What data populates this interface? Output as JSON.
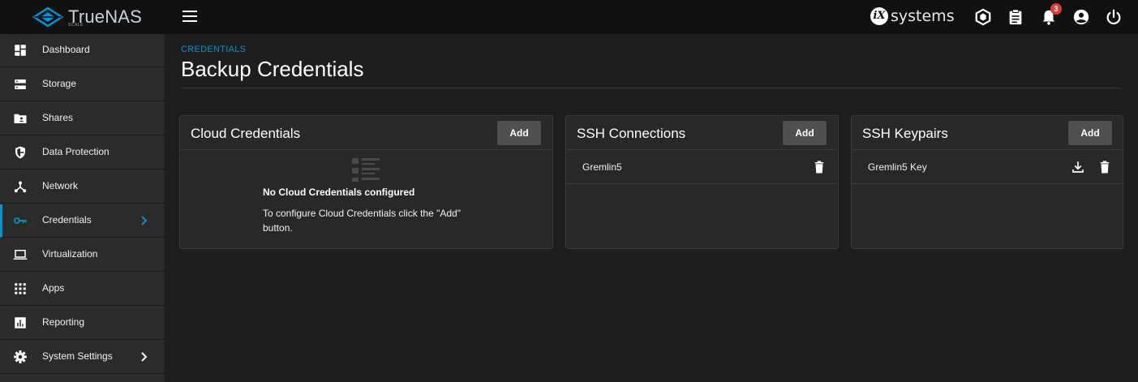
{
  "app": {
    "logo_brand": "TrueNAS",
    "logo_edition": "SCALE",
    "vendor_badge": "iX",
    "vendor_name": "systems",
    "notifications_count": "3"
  },
  "sidebar": {
    "items": [
      {
        "label": "Dashboard",
        "icon": "dashboard-icon"
      },
      {
        "label": "Storage",
        "icon": "storage-icon"
      },
      {
        "label": "Shares",
        "icon": "shares-icon"
      },
      {
        "label": "Data Protection",
        "icon": "security-icon"
      },
      {
        "label": "Network",
        "icon": "network-icon"
      },
      {
        "label": "Credentials",
        "icon": "key-icon",
        "active": true
      },
      {
        "label": "Virtualization",
        "icon": "laptop-icon"
      },
      {
        "label": "Apps",
        "icon": "apps-icon"
      },
      {
        "label": "Reporting",
        "icon": "reporting-icon"
      },
      {
        "label": "System Settings",
        "icon": "gear-icon"
      }
    ]
  },
  "page": {
    "breadcrumb": "CREDENTIALS",
    "title": "Backup Credentials"
  },
  "cards": {
    "cloud": {
      "title": "Cloud Credentials",
      "add_label": "Add",
      "empty_title": "No Cloud Credentials configured",
      "empty_desc": "To configure Cloud Credentials click the \"Add\" button."
    },
    "ssh_connections": {
      "title": "SSH Connections",
      "add_label": "Add",
      "rows": [
        {
          "name": "Gremlin5"
        }
      ]
    },
    "ssh_keypairs": {
      "title": "SSH Keypairs",
      "add_label": "Add",
      "rows": [
        {
          "name": "Gremlin5 Key"
        }
      ]
    }
  },
  "colors": {
    "accent": "#0095d5",
    "topbar": "#111111",
    "sidebar": "#2b2b2b",
    "background": "#1e1e1e",
    "card": "#282828",
    "notification": "#e53935"
  }
}
